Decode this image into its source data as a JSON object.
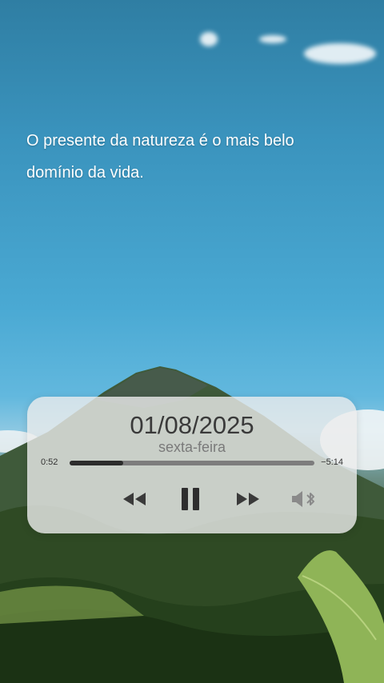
{
  "quote": {
    "line1": "O presente da natureza é o mais belo",
    "line2": "domínio da vida."
  },
  "player": {
    "date": "01/08/2025",
    "weekday": "sexta-feira",
    "elapsed": "0:52",
    "remaining": "−5:14",
    "progress_fraction": 0.22,
    "controls": {
      "rewind_icon": "rewind-icon",
      "pause_icon": "pause-icon",
      "forward_icon": "fast-forward-icon",
      "audio_icon": "speaker-bluetooth-icon"
    }
  },
  "colors": {
    "sky": "#4aa9d3",
    "panel": "#ececec",
    "date_text": "#3a3a3a",
    "weekday_text": "#7a7a7a",
    "track": "#7d7d7d",
    "track_fill": "#2c2c2c"
  }
}
